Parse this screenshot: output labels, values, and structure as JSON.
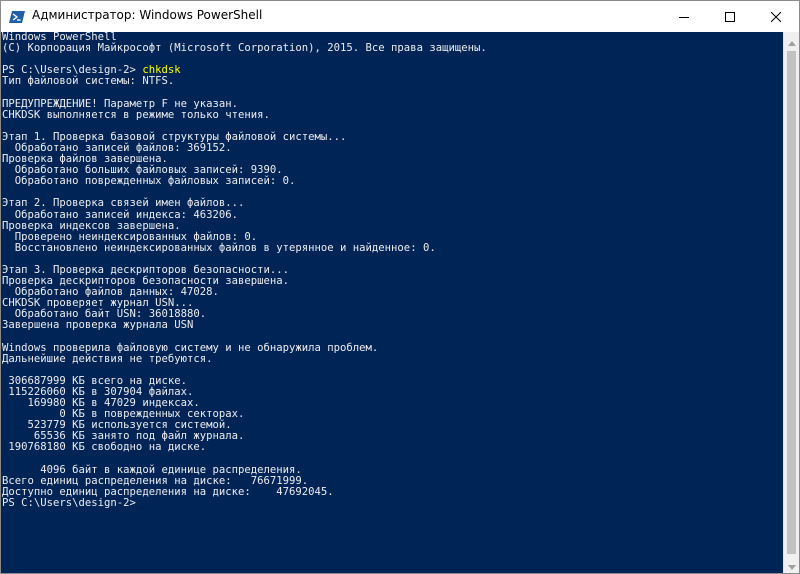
{
  "window": {
    "title": "Администратор: Windows PowerShell",
    "icon": "powershell-icon",
    "controls": [
      "minimize-icon",
      "maximize-icon",
      "close-icon"
    ]
  },
  "colors": {
    "console_background": "#012456",
    "console_text": "#eeedf0",
    "command_text": "#ffff00"
  },
  "console": {
    "lines": [
      "Windows PowerShell",
      "(C) Корпорация Майкрософт (Microsoft Corporation), 2015. Все права защищены.",
      "",
      "",
      "Тип файловой системы: NTFS.",
      "",
      "ПРЕДУПРЕЖДЕНИЕ! Параметр F не указан.",
      "CHKDSK выполняется в режиме только чтения.",
      "",
      "Этап 1. Проверка базовой структуры файловой системы...",
      "  Обработано записей файлов: 369152.",
      "Проверка файлов завершена.",
      "  Обработано больших файловых записей: 9390.",
      "  Обработано поврежденных файловых записей: 0.",
      "",
      "Этап 2. Проверка связей имен файлов...",
      "  Обработано записей индекса: 463206.",
      "Проверка индексов завершена.",
      "  Проверено неиндексированных файлов: 0.",
      "  Восстановлено неиндексированных файлов в утерянное и найденное: 0.",
      "",
      "Этап 3. Проверка дескрипторов безопасности...",
      "Проверка дескрипторов безопасности завершена.",
      "  Обработано файлов данных: 47028.",
      "CHKDSK проверяет журнал USN...",
      "  Обработано байт USN: 36018880.",
      "Завершена проверка журнала USN",
      "",
      "Windows проверила файловую систему и не обнаружила проблем.",
      "Дальнейшие действия не требуются.",
      "",
      " 306687999 КБ всего на диске.",
      " 115226060 КБ в 307904 файлах.",
      "    169980 КБ в 47029 индексах.",
      "         0 КБ в поврежденных секторах.",
      "    523779 КБ используется системой.",
      "     65536 КБ занято под файл журнала.",
      " 190768180 КБ свободно на диске.",
      "",
      "      4096 байт в каждой единице распределения.",
      "Всего единиц распределения на диске:   76671999.",
      "Доступно единиц распределения на диске:    47692045.",
      "PS C:\\Users\\design-2>"
    ],
    "prompt_line": {
      "prompt": "PS C:\\Users\\design-2> ",
      "command": "chkdsk"
    }
  }
}
